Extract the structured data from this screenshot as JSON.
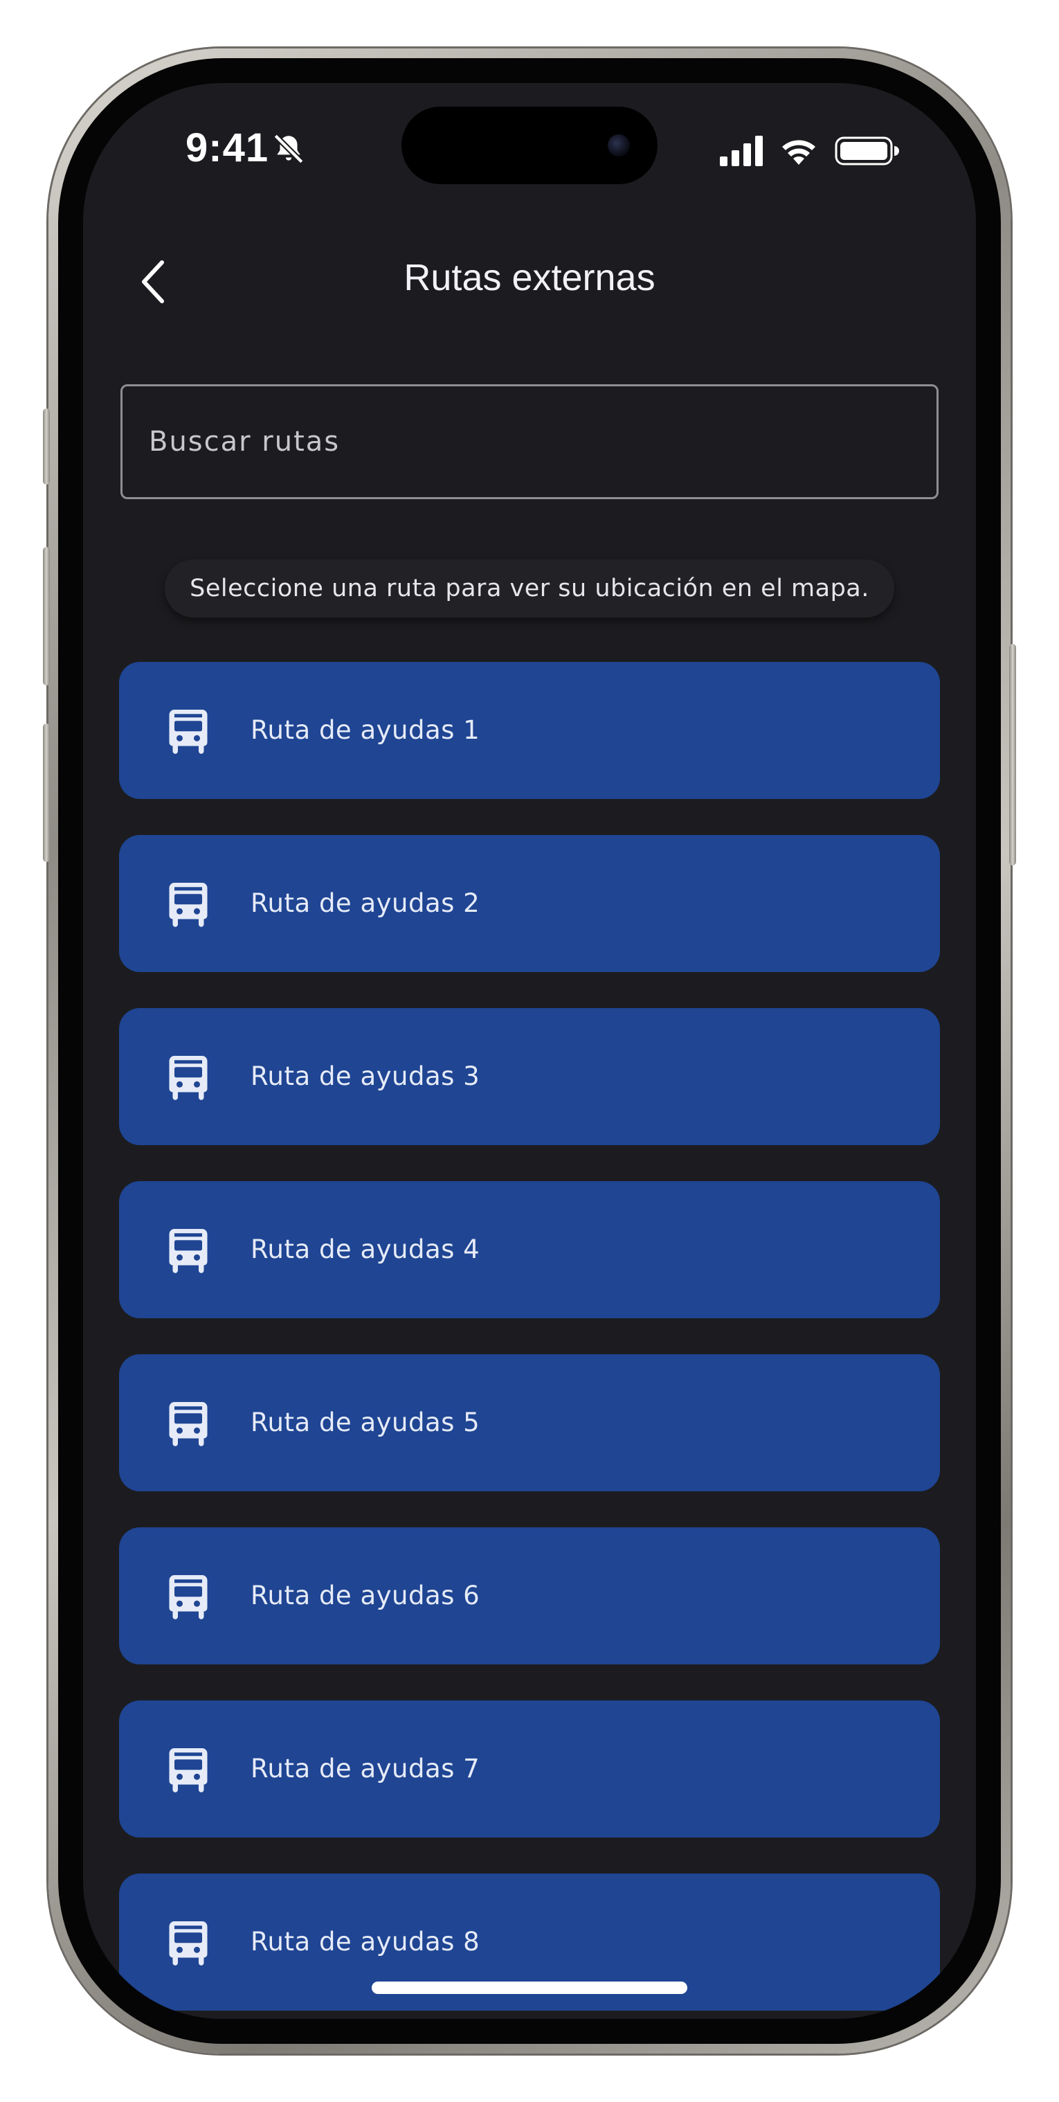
{
  "status_bar": {
    "time": "9:41"
  },
  "header": {
    "title": "Rutas externas"
  },
  "search": {
    "placeholder": "Buscar rutas",
    "value": ""
  },
  "hint": {
    "text": "Seleccione una ruta para ver su ubicación en el mapa."
  },
  "routes": [
    {
      "label": "Ruta de ayudas 1"
    },
    {
      "label": "Ruta de ayudas 2"
    },
    {
      "label": "Ruta de ayudas 3"
    },
    {
      "label": "Ruta de ayudas 4"
    },
    {
      "label": "Ruta de ayudas 5"
    },
    {
      "label": "Ruta de ayudas 6"
    },
    {
      "label": "Ruta de ayudas 7"
    },
    {
      "label": "Ruta de ayudas 8"
    }
  ],
  "icons": {
    "route_item": "bus-icon",
    "back": "chevron-left-icon",
    "silent": "bell-slash-icon",
    "signal": "cellular-signal-icon",
    "wifi": "wifi-icon",
    "battery": "battery-icon"
  },
  "colors": {
    "background": "#1c1c20",
    "route_item": "#1f4593",
    "route_text": "#e6ebf7",
    "search_border": "#8e8e93"
  }
}
